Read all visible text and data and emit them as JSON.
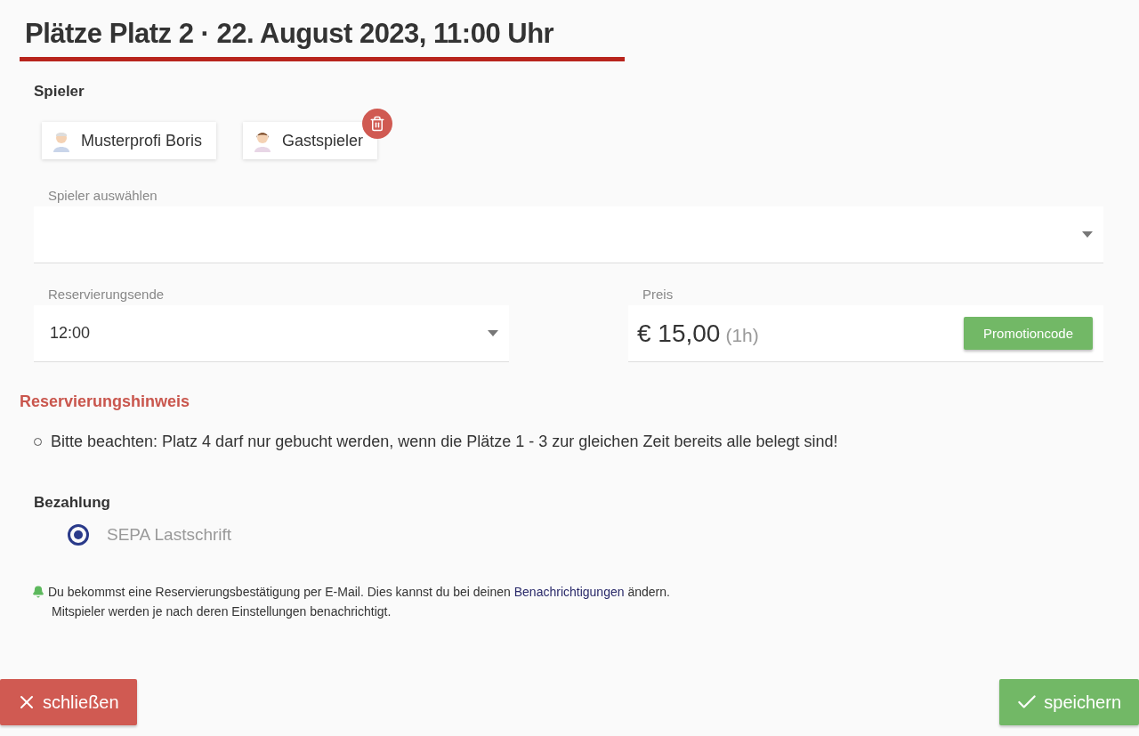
{
  "title": "Plätze Platz 2 · 22. August 2023, 11:00 Uhr",
  "players": {
    "label": "Spieler",
    "items": [
      {
        "name": "Musterprofi Boris",
        "kind": "male",
        "removable": false
      },
      {
        "name": "Gastspieler",
        "kind": "female",
        "removable": true
      }
    ]
  },
  "player_select": {
    "label": "Spieler auswählen"
  },
  "reservation_end": {
    "label": "Reservierungsende",
    "value": "12:00"
  },
  "price": {
    "label": "Preis",
    "amount": "€ 15,00",
    "duration": "(1h)",
    "button": "Promotioncode"
  },
  "note": {
    "heading": "Reservierungshinweis",
    "items": [
      "Bitte beachten: Platz 4 darf nur gebucht werden, wenn die Plätze 1 - 3 zur gleichen Zeit bereits alle belegt sind!"
    ]
  },
  "payment": {
    "label": "Bezahlung",
    "options": [
      {
        "label": "SEPA Lastschrift",
        "selected": true
      }
    ]
  },
  "notification": {
    "before": "Du bekommst eine Reservierungsbestätigung per E-Mail. Dies kannst du bei deinen ",
    "link": "Benachrichtigungen",
    "after": " ändern.",
    "second_line": "Mitspieler werden je nach deren Einstellungen benachrichtigt."
  },
  "buttons": {
    "close": "schließen",
    "save": "speichern"
  }
}
